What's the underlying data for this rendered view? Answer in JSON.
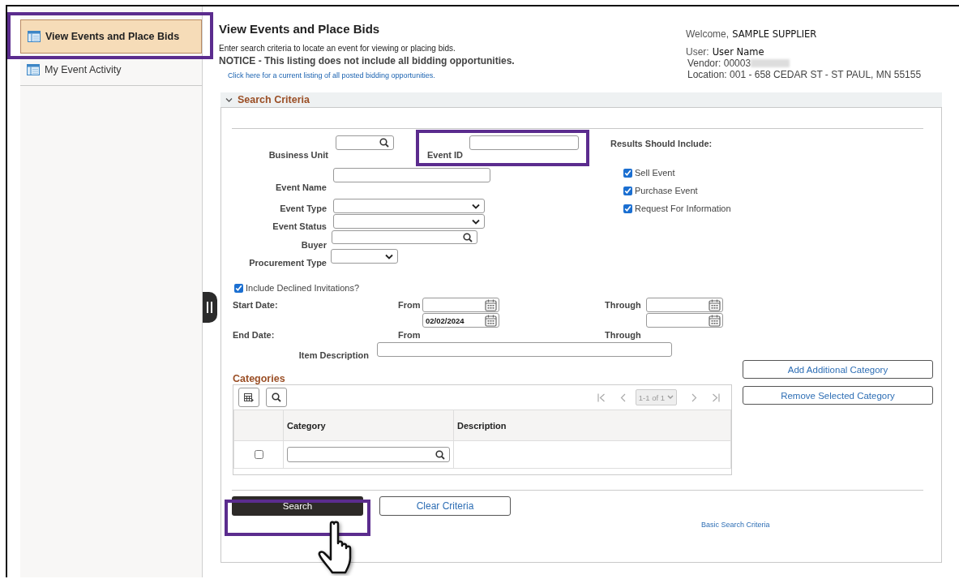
{
  "sidebar": {
    "items": [
      {
        "label": "View Events and Place Bids",
        "selected": true
      },
      {
        "label": "My Event Activity",
        "selected": false
      }
    ]
  },
  "header": {
    "title": "View Events and Place Bids",
    "instructions": "Enter search criteria to locate an event for viewing or placing bids.",
    "notice": "NOTICE - This listing does not include all bidding opportunities.",
    "link": "Click here for a current listing of all posted bidding opportunities."
  },
  "user_info": {
    "welcome_label": "Welcome,",
    "welcome_name": "SAMPLE SUPPLIER",
    "user_label": "User:",
    "user_name": "User Name",
    "vendor": "Vendor: 00003",
    "location": "Location: 001 - 658 CEDAR ST - ST PAUL, MN  55155"
  },
  "search_criteria": {
    "title": "Search Criteria",
    "expanded": true,
    "business_unit": {
      "label": "Business Unit"
    },
    "event_id": {
      "label": "Event ID"
    },
    "event_name": {
      "label": "Event Name"
    },
    "event_type": {
      "label": "Event Type"
    },
    "event_status": {
      "label": "Event Status"
    },
    "buyer": {
      "label": "Buyer"
    },
    "procurement_type": {
      "label": "Procurement Type"
    },
    "results": {
      "title": "Results Should Include:",
      "options": [
        {
          "label": "Sell Event",
          "checked": true
        },
        {
          "label": "Purchase Event",
          "checked": true
        },
        {
          "label": "Request For Information",
          "checked": true
        }
      ]
    },
    "include_declined": {
      "label": "Include Declined Invitations?",
      "checked": true
    },
    "dates": {
      "rows": [
        {
          "label": "Start Date:",
          "from": "From",
          "through": "Through"
        },
        {
          "label": "End Date:",
          "from": "From",
          "through": "Through"
        }
      ],
      "second_from_value": "02/02/2024"
    },
    "item_description": {
      "label": "Item Description"
    },
    "category_buttons": [
      "Add Additional Category",
      "Remove Selected Category"
    ],
    "categories": {
      "title": "Categories",
      "pager": "1-1 of 1",
      "columns": [
        "Category",
        "Description"
      ],
      "rows": [
        {
          "selected": false
        }
      ]
    },
    "actions": {
      "search": "Search",
      "clear": "Clear Criteria",
      "link": "Basic Search Criteria"
    }
  }
}
